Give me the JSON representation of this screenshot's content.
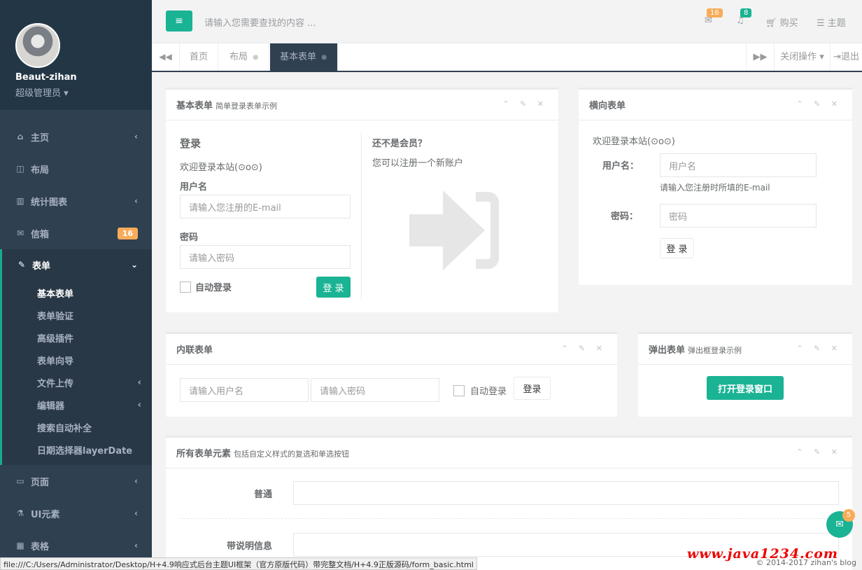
{
  "sidebar": {
    "user_name": "Beaut-zihan",
    "user_role": "超级管理员 ▾",
    "items": [
      {
        "label": "主页",
        "icon": "home-icon",
        "glyph": "⌂",
        "arrow": "‹"
      },
      {
        "label": "布局",
        "icon": "columns-icon",
        "glyph": "◫"
      },
      {
        "label": "统计图表",
        "icon": "bar-chart-icon",
        "glyph": "▥",
        "arrow": "‹"
      },
      {
        "label": "信箱",
        "icon": "envelope-icon",
        "glyph": "✉",
        "badge": "16"
      },
      {
        "label": "表单",
        "icon": "edit-icon",
        "glyph": "✎",
        "arrow": "⌄"
      }
    ],
    "form_subitems": [
      "基本表单",
      "表单验证",
      "高级插件",
      "表单向导",
      "文件上传",
      "编辑器",
      "搜索自动补全",
      "日期选择器layerDate"
    ],
    "sub_arrow": "‹",
    "bottom_items": [
      {
        "label": "页面",
        "glyph": "▭",
        "arrow": "‹"
      },
      {
        "label": "UI元素",
        "glyph": "⚗",
        "arrow": "‹"
      },
      {
        "label": "表格",
        "glyph": "▦",
        "arrow": "‹"
      }
    ]
  },
  "topbar": {
    "menu_glyph": "≡",
    "search_placeholder": "请输入您需要查找的内容 ...",
    "mail_badge": "16",
    "bell_badge": "8",
    "buy_label": "购买",
    "theme_label": "主题"
  },
  "tabs": {
    "prev_glyph": "◀◀",
    "next_glyph": "▶▶",
    "items": [
      "首页",
      "布局",
      "基本表单"
    ],
    "close_glyph": "⊗",
    "close_ops": "关闭操作 ▾",
    "logout": "退出"
  },
  "basic_form": {
    "title": "基本表单",
    "subtitle": "简单登录表单示例",
    "login_heading": "登录",
    "welcome": "欢迎登录本站(⊙o⊙)",
    "username_label": "用户名",
    "username_placeholder": "请输入您注册的E-mail",
    "password_label": "密码",
    "password_placeholder": "请输入密码",
    "remember_label": "自动登录",
    "login_button": "登 录",
    "not_member_heading": "还不是会员？",
    "register_text": "您可以注册一个新账户"
  },
  "horizontal_form": {
    "title": "横向表单",
    "welcome": "欢迎登录本站(⊙o⊙)",
    "username_label": "用户名：",
    "username_placeholder": "用户名",
    "username_help": "请输入您注册时所填的E-mail",
    "password_label": "密码：",
    "password_placeholder": "密码",
    "login_button": "登 录"
  },
  "inline_form": {
    "title": "内联表单",
    "username_placeholder": "请输入用户名",
    "password_placeholder": "请输入密码",
    "remember_label": "自动登录",
    "login_button": "登录"
  },
  "modal_form": {
    "title": "弹出表单",
    "subtitle": "弹出框登录示例",
    "open_button": "打开登录窗口"
  },
  "all_elements": {
    "title": "所有表单元素",
    "subtitle": "包括自定义样式的复选和单选按钮",
    "normal_label": "普通",
    "help_label": "带说明信息"
  },
  "panel_tools": "⌃ ✎ ✕",
  "chat": {
    "badge": "5",
    "glyph": "✉"
  },
  "footer": {
    "copyright": "© 2014-2017 zihan's blog",
    "watermark": "www.java1234.com"
  },
  "status_bar": "file:///C:/Users/Administrator/Desktop/H+4.9响应式后台主题UI框架（官方原版代码）带完整文档/H+4.9正版源码/form_basic.html",
  "colors": {
    "primary": "#1ab394",
    "sidebar": "#2f4050",
    "warning": "#f8ac59"
  }
}
